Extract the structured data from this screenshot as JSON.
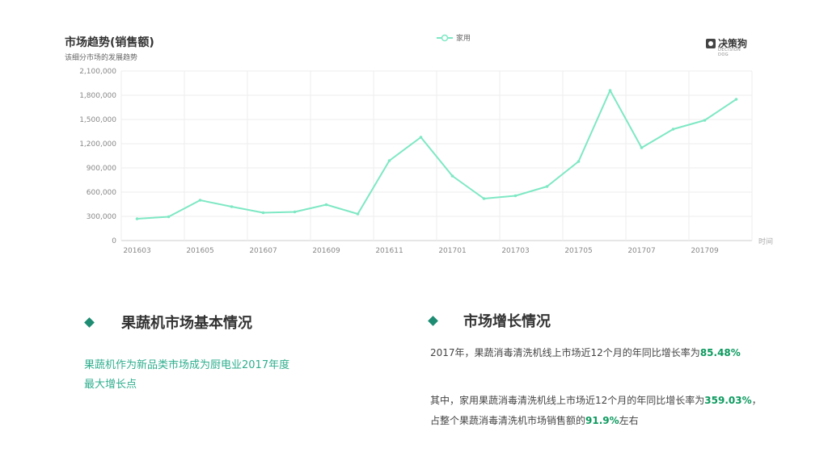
{
  "chart_data": {
    "type": "line",
    "title": "市场趋势(销售额)",
    "subtitle": "该细分市场的发展趋势",
    "x": [
      "201603",
      "201604",
      "201605",
      "201606",
      "201607",
      "201608",
      "201609",
      "201610",
      "201611",
      "201612",
      "201701",
      "201702",
      "201703",
      "201704",
      "201705",
      "201706",
      "201707",
      "201708",
      "201709",
      "201710"
    ],
    "x_tick_labels": [
      "201603",
      "201605",
      "201607",
      "201609",
      "201611",
      "201701",
      "201703",
      "201705",
      "201707",
      "201709"
    ],
    "series": [
      {
        "name": "家用",
        "values": [
          270000,
          295000,
          500000,
          420000,
          345000,
          355000,
          445000,
          330000,
          990000,
          1280000,
          800000,
          520000,
          555000,
          670000,
          980000,
          1860000,
          1150000,
          1380000,
          1490000,
          1750000
        ]
      }
    ],
    "y_ticks": [
      "0",
      "300,000",
      "600,000",
      "900,000",
      "1,200,000",
      "1,500,000",
      "1,800,000",
      "2,100,000"
    ],
    "ylim": [
      0,
      2100000
    ],
    "xlabel": "时间",
    "ylabel": "",
    "grid": true,
    "legend_position": "top-center",
    "line_color": "#7ee8c4"
  },
  "logo": {
    "name": "决策狗",
    "sub": "DECISION DOG"
  },
  "left_section": {
    "title": "果蔬机市场基本情况",
    "body_line1": "果蔬机作为新品类市场成为厨电业2017年度",
    "body_line2": "最大增长点"
  },
  "right_section": {
    "title": "市场增长情况",
    "p1_text": "2017年，果蔬消毒清洗机线上市场近12个月的年同比增长率为",
    "p1_value": "85.48%",
    "p2_text1": "其中，家用果蔬消毒清洗机线上市场近12个月的年同比增长率为",
    "p2_value1": "359.03%",
    "p2_text2": "，占整个果蔬消毒清洗机市场销售额的",
    "p2_value2": "91.9%",
    "p2_text3": "左右"
  },
  "colors": {
    "accent": "#1e8c72",
    "highlight": "#0c9a5e",
    "body_green": "#2fae8e",
    "line": "#7ee8c4"
  }
}
